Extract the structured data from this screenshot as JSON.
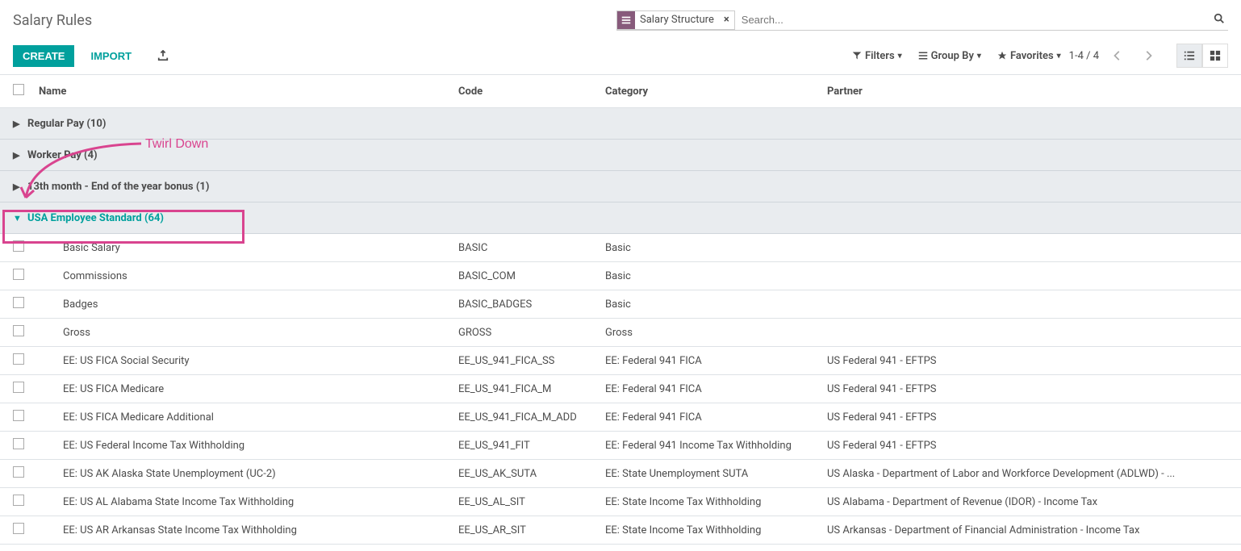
{
  "title": "Salary Rules",
  "search": {
    "facet_label": "Salary Structure",
    "facet_remove": "×",
    "placeholder": "Search..."
  },
  "buttons": {
    "create": "CREATE",
    "import": "IMPORT"
  },
  "dropdowns": {
    "filters": "Filters",
    "groupby": "Group By",
    "favorites": "Favorites"
  },
  "pager": "1-4 / 4",
  "columns": {
    "name": "Name",
    "code": "Code",
    "category": "Category",
    "partner": "Partner"
  },
  "groups": [
    {
      "label": "Regular Pay (10)",
      "expanded": false
    },
    {
      "label": "Worker Pay (4)",
      "expanded": false
    },
    {
      "label": "13th month - End of the year bonus (1)",
      "expanded": false
    },
    {
      "label": "USA Employee Standard (64)",
      "expanded": true
    }
  ],
  "rows": [
    {
      "name": "Basic Salary",
      "code": "BASIC",
      "category": "Basic",
      "partner": ""
    },
    {
      "name": "Commissions",
      "code": "BASIC_COM",
      "category": "Basic",
      "partner": ""
    },
    {
      "name": "Badges",
      "code": "BASIC_BADGES",
      "category": "Basic",
      "partner": ""
    },
    {
      "name": "Gross",
      "code": "GROSS",
      "category": "Gross",
      "partner": ""
    },
    {
      "name": "EE: US FICA Social Security",
      "code": "EE_US_941_FICA_SS",
      "category": "EE: Federal 941 FICA",
      "partner": "US Federal 941 - EFTPS"
    },
    {
      "name": "EE: US FICA Medicare",
      "code": "EE_US_941_FICA_M",
      "category": "EE: Federal 941 FICA",
      "partner": "US Federal 941 - EFTPS"
    },
    {
      "name": "EE: US FICA Medicare Additional",
      "code": "EE_US_941_FICA_M_ADD",
      "category": "EE: Federal 941 FICA",
      "partner": "US Federal 941 - EFTPS"
    },
    {
      "name": "EE: US Federal Income Tax Withholding",
      "code": "EE_US_941_FIT",
      "category": "EE: Federal 941 Income Tax Withholding",
      "partner": "US Federal 941 - EFTPS"
    },
    {
      "name": "EE: US AK Alaska State Unemployment (UC-2)",
      "code": "EE_US_AK_SUTA",
      "category": "EE: State Unemployment SUTA",
      "partner": "US Alaska - Department of Labor and Workforce Development (ADLWD) - ..."
    },
    {
      "name": "EE: US AL Alabama State Income Tax Withholding",
      "code": "EE_US_AL_SIT",
      "category": "EE: State Income Tax Withholding",
      "partner": "US Alabama - Department of Revenue (IDOR) - Income Tax"
    },
    {
      "name": "EE: US AR Arkansas State Income Tax Withholding",
      "code": "EE_US_AR_SIT",
      "category": "EE: State Income Tax Withholding",
      "partner": "US Arkansas - Department of Financial Administration - Income Tax"
    }
  ],
  "annotation": "Twirl Down"
}
